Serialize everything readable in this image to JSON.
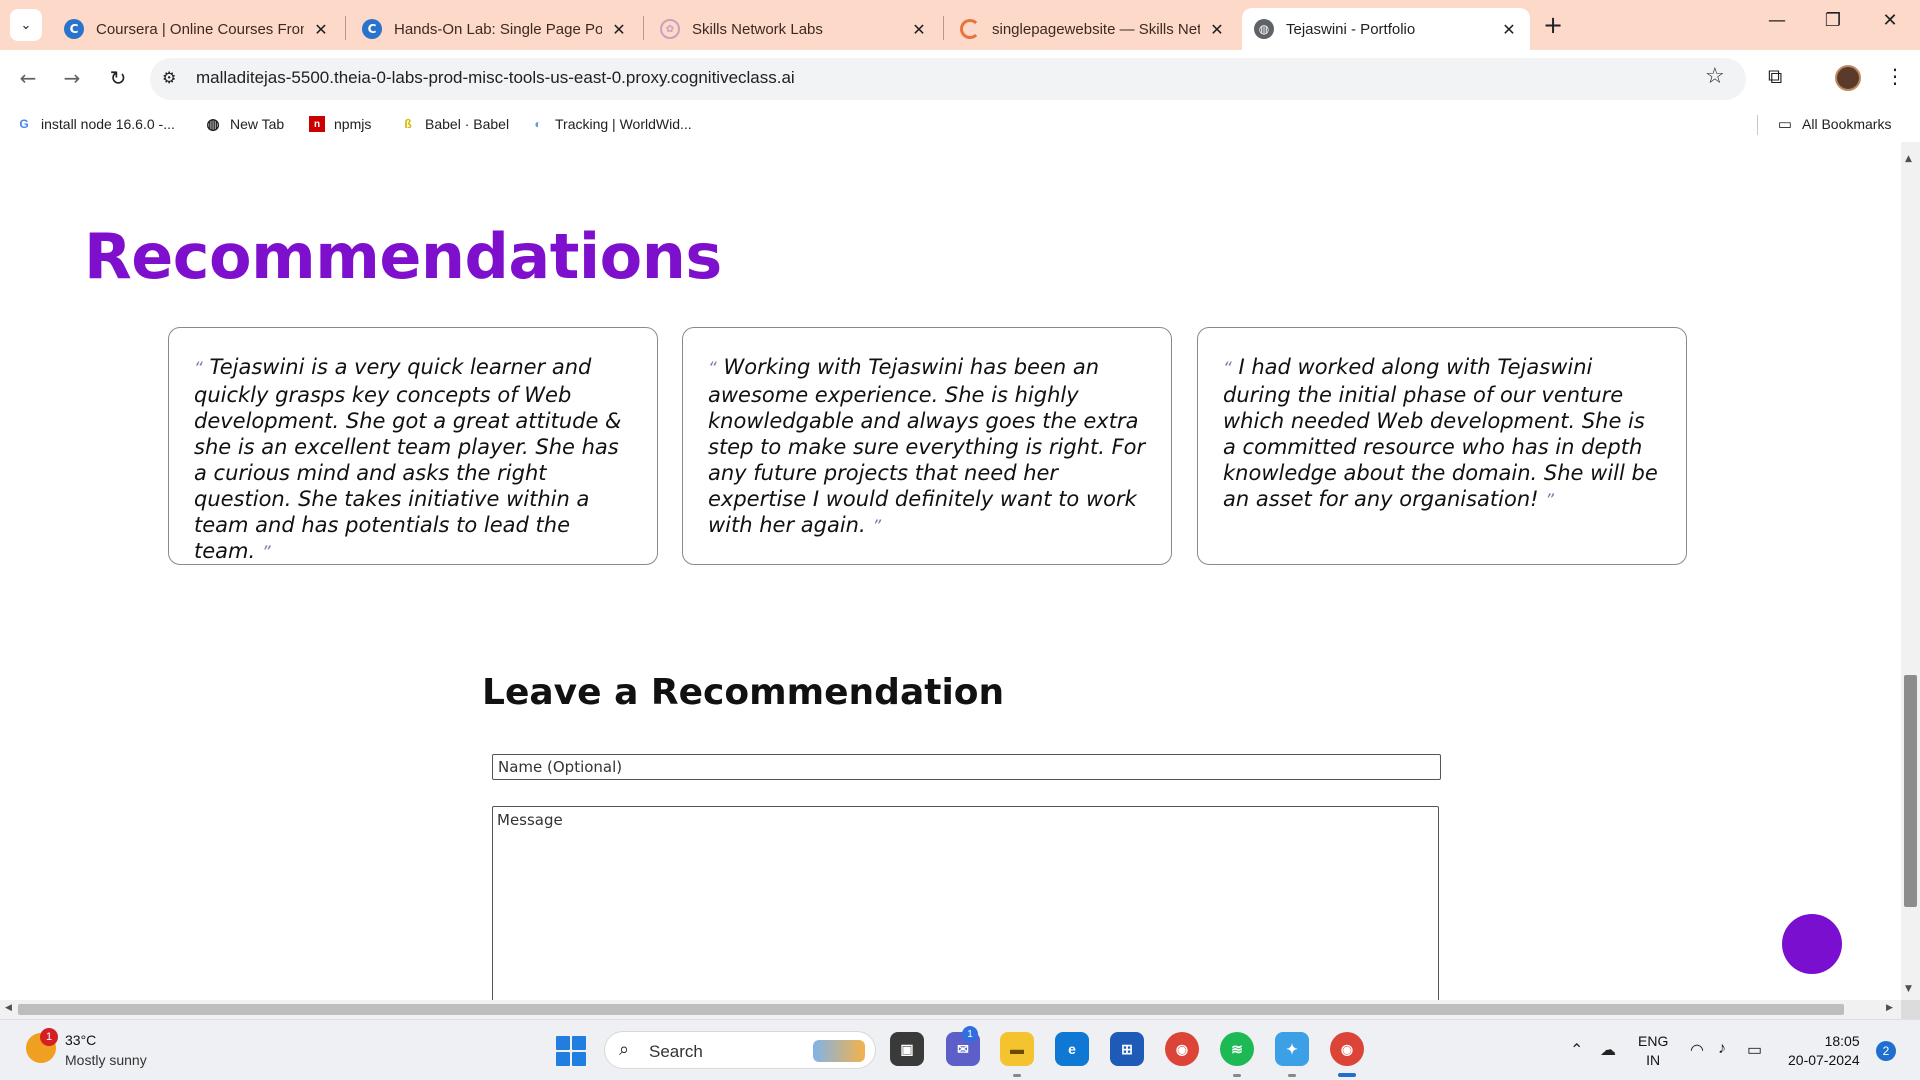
{
  "browser": {
    "tabs": [
      {
        "title": "Coursera | Online Courses From",
        "icon": "coursera-icon"
      },
      {
        "title": "Hands-On Lab: Single Page Por",
        "icon": "coursera-icon"
      },
      {
        "title": "Skills Network Labs",
        "icon": "skills-network-icon"
      },
      {
        "title": "singlepagewebsite — Skills Net",
        "icon": "loading-spinner-icon"
      },
      {
        "title": "Tejaswini - Portfolio",
        "icon": "globe-icon",
        "active": true
      }
    ],
    "url": "malladitejas-5500.theia-0-labs-prod-misc-tools-us-east-0.proxy.cognitiveclass.ai",
    "bookmarks": [
      {
        "label": "install node 16.6.0 -...",
        "icon": "google-icon"
      },
      {
        "label": "New Tab",
        "icon": "globe-icon"
      },
      {
        "label": "npmjs",
        "icon": "npm-icon"
      },
      {
        "label": "Babel · Babel",
        "icon": "babel-icon"
      },
      {
        "label": "Tracking | WorldWid...",
        "icon": "tracking-icon"
      }
    ],
    "all_bookmarks": "All Bookmarks"
  },
  "page": {
    "section_title": "Recommendations",
    "open_quote": "“",
    "close_quote": "”",
    "recommendations": [
      "Tejaswini is a very quick learner and quickly grasps key concepts of Web development. She got a great attitude & she is an excellent team player. She has a curious mind and asks the right question. She takes initiative within a team and has potentials to lead the team.",
      "Working with Tejaswini has been an awesome experience. She is highly knowledgable and always goes the extra step to make sure everything is right. For any future projects that need her expertise I would definitely want to work with her again.",
      "I had worked along with Tejaswini during the initial phase of our venture which needed Web development. She is a committed resource who has in depth knowledge about the domain. She will be an asset for any organisation!"
    ],
    "form": {
      "title": "Leave a Recommendation",
      "name_placeholder": "Name (Optional)",
      "message_placeholder": "Message"
    },
    "accent_color": "#7e0fcc"
  },
  "taskbar": {
    "weather": {
      "temp": "33°C",
      "condition": "Mostly sunny",
      "badge": "1"
    },
    "search_label": "Search",
    "teams_badge": "1",
    "language": {
      "line1": "ENG",
      "line2": "IN"
    },
    "time": "18:05",
    "date": "20-07-2024",
    "notifications": "2"
  }
}
